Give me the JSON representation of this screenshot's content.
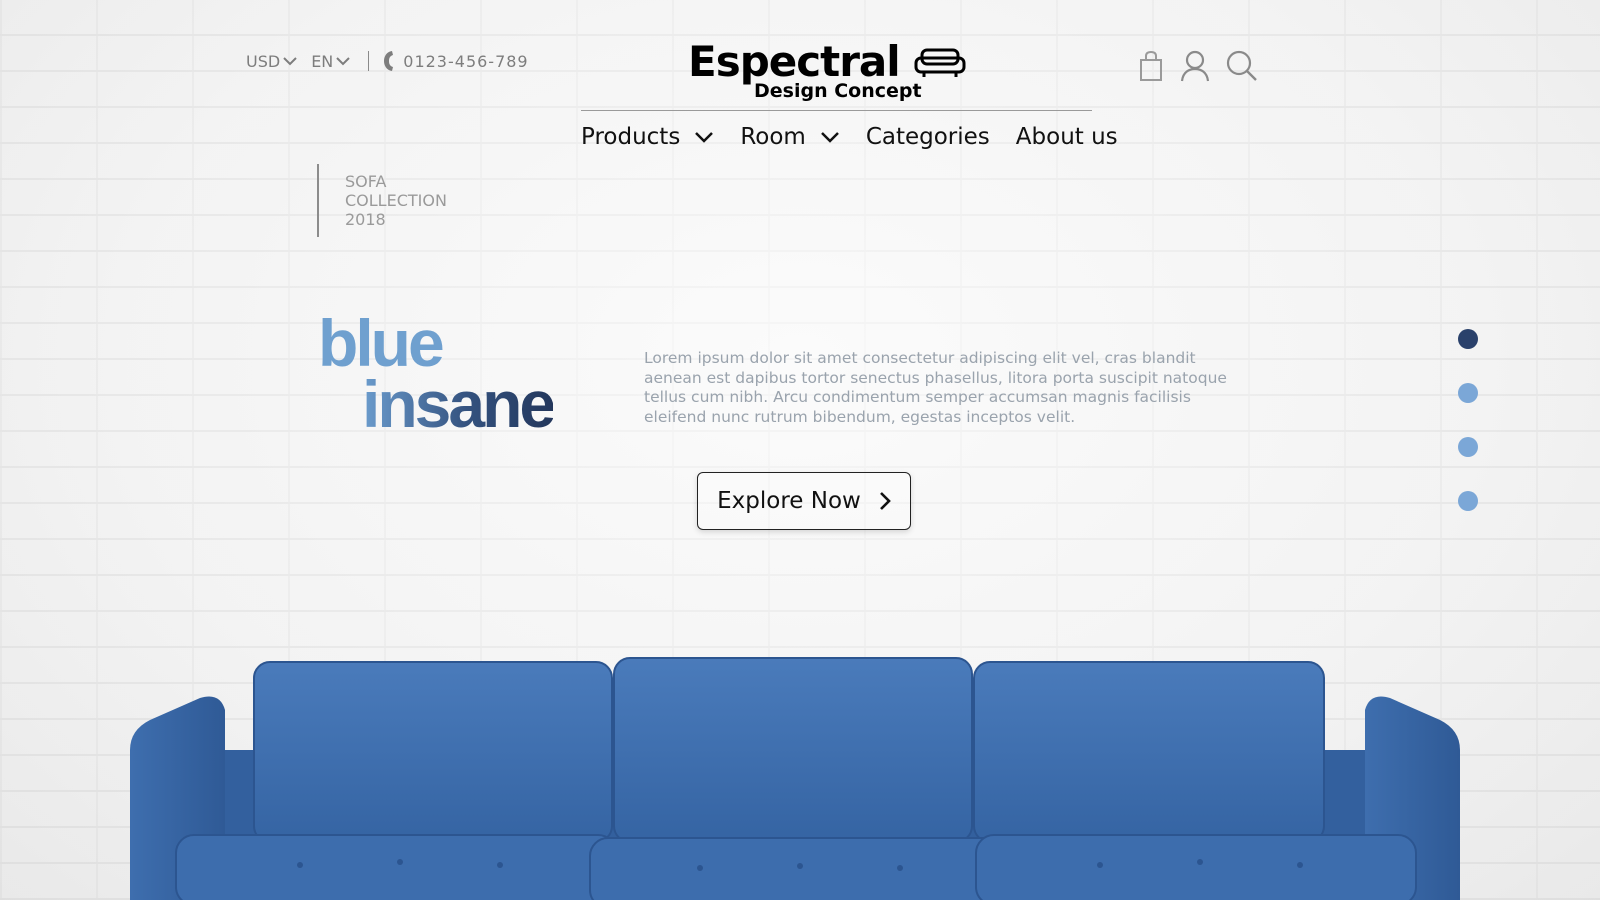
{
  "topbar": {
    "currency": "USD",
    "language": "EN",
    "phone": "0123-456-789"
  },
  "logo": {
    "title": "Espectral",
    "subtitle": "Design Concept"
  },
  "nav": {
    "items": [
      {
        "label": "Products",
        "has_dropdown": true
      },
      {
        "label": "Room",
        "has_dropdown": true
      },
      {
        "label": "Categories",
        "has_dropdown": false
      },
      {
        "label": "About us",
        "has_dropdown": false
      }
    ]
  },
  "collection": {
    "line1": "SOFA",
    "line2": "COLLECTION",
    "line3": "2018"
  },
  "hero": {
    "word1": "blue",
    "word2": "insane",
    "description": "Lorem ipsum dolor sit amet consectetur adipiscing elit vel, cras blandit aenean est dapibus tortor senectus phasellus, litora porta suscipit natoque tellus cum nibh. Arcu condimentum semper accumsan magnis facilisis eleifend nunc rutrum bibendum, egestas inceptos velit.",
    "cta_label": "Explore Now"
  },
  "slider": {
    "count": 4,
    "active_index": 0
  },
  "colors": {
    "accent_light": "#7ba7d7",
    "accent_dark": "#2a416b",
    "sofa": "#3f6fae"
  },
  "icons": [
    "chevron-down-icon",
    "phone-icon",
    "sofa-icon",
    "shopping-bag-icon",
    "user-icon",
    "search-icon",
    "chevron-right-icon"
  ]
}
